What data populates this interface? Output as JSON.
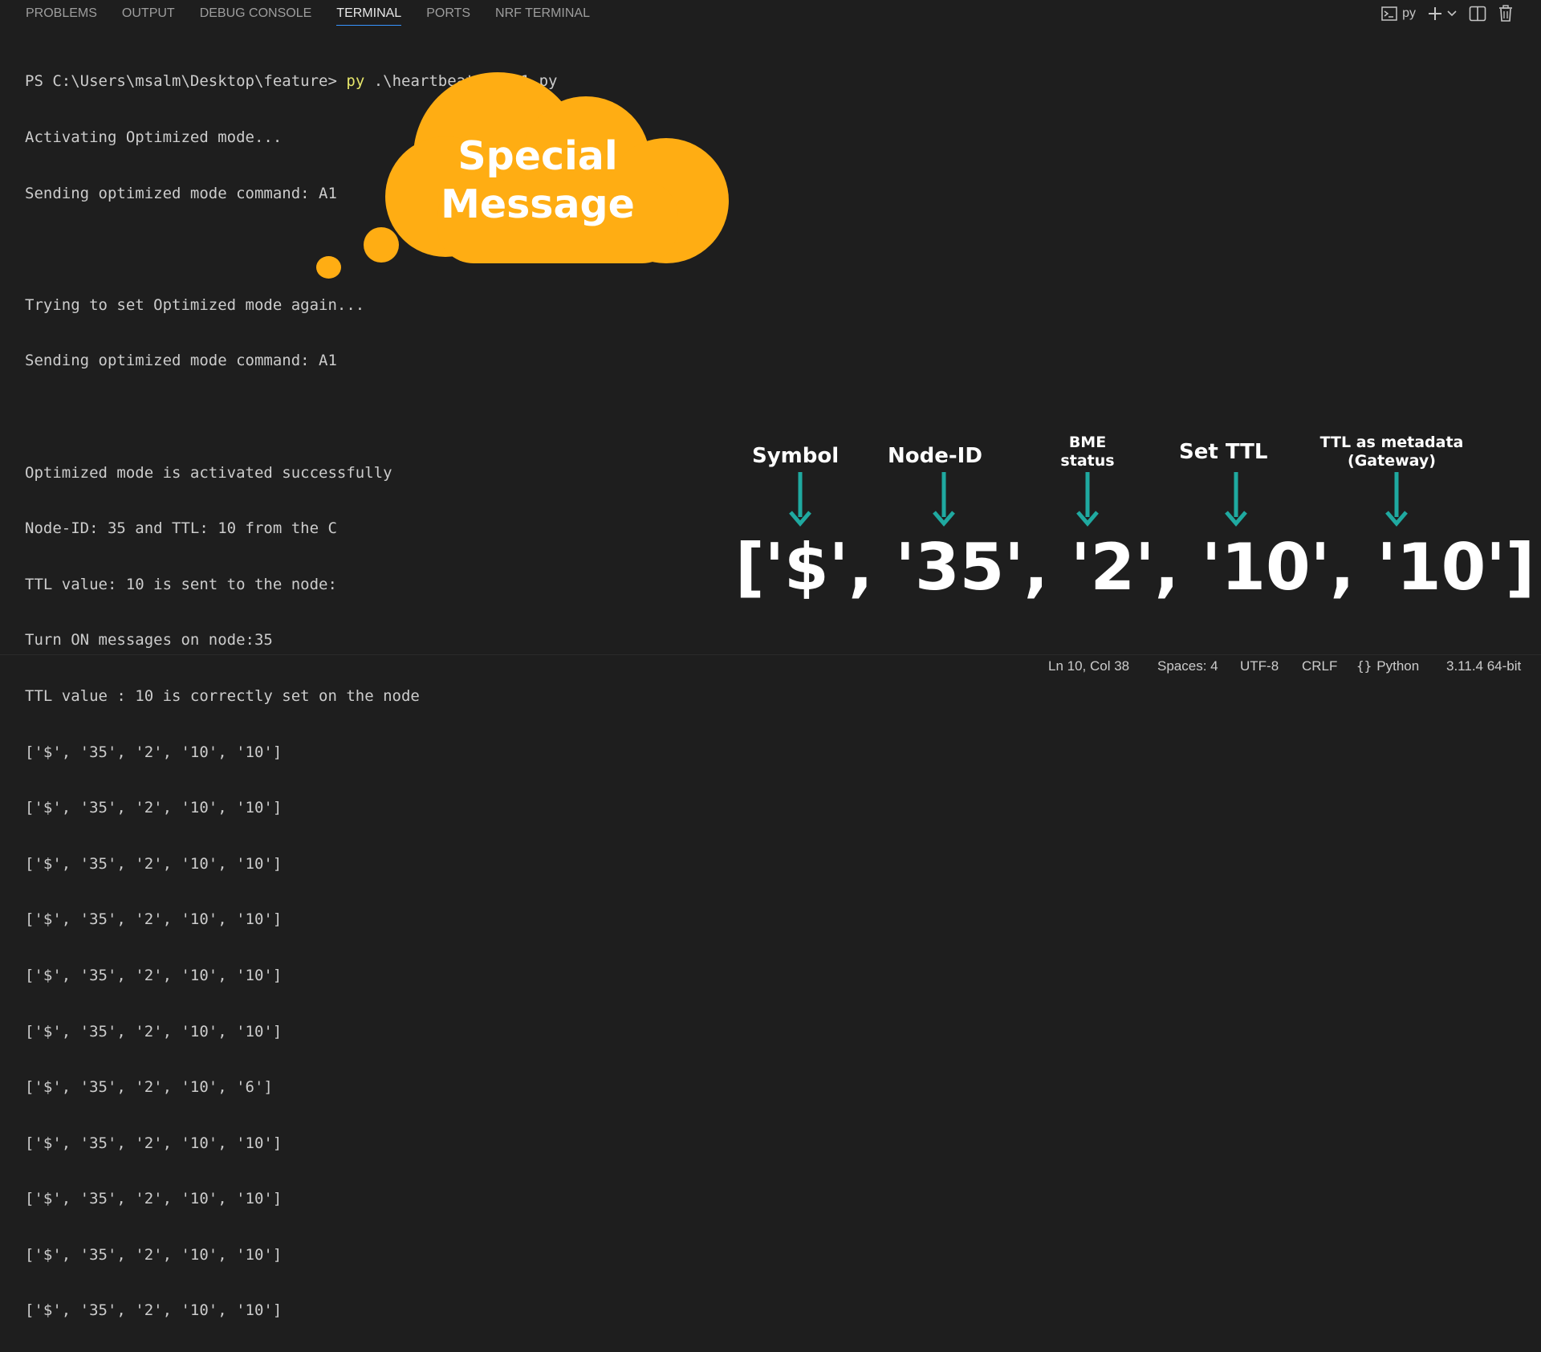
{
  "tabs": [
    {
      "label": "PROBLEMS"
    },
    {
      "label": "OUTPUT"
    },
    {
      "label": "DEBUG CONSOLE"
    },
    {
      "label": "TERMINAL",
      "active": true
    },
    {
      "label": "PORTS"
    },
    {
      "label": "NRF TERMINAL"
    }
  ],
  "terminal_actions": {
    "shell_label": "py"
  },
  "terminal": {
    "prompt": "PS C:\\Users\\msalm\\Desktop\\feature> ",
    "command": "py",
    "args": " .\\heartbeat_V1.01.py",
    "lines": [
      "Activating Optimized mode...",
      "Sending optimized mode command: A1",
      "",
      "Trying to set Optimized mode again...",
      "Sending optimized mode command: A1",
      "",
      "Optimized mode is activated successfully",
      "Node-ID: 35 and TTL: 10 from the C",
      "TTL value: 10 is sent to the node:",
      "Turn ON messages on node:35",
      "TTL value : 10 is correctly set on the node",
      "['$', '35', '2', '10', '10']",
      "['$', '35', '2', '10', '10']",
      "['$', '35', '2', '10', '10']",
      "['$', '35', '2', '10', '10']",
      "['$', '35', '2', '10', '10']",
      "['$', '35', '2', '10', '10']",
      "['$', '35', '2', '10', '6']",
      "['$', '35', '2', '10', '10']",
      "['$', '35', '2', '10', '10']",
      "['$', '35', '2', '10', '10']",
      "['$', '35', '2', '10', '10']"
    ]
  },
  "overlay": {
    "cloud_line1": "Special",
    "cloud_line2": "Message",
    "cloud_color": "#ffad13",
    "arrow_color": "#1fa9a0",
    "labels": {
      "symbol": "Symbol",
      "node_id": "Node-ID",
      "bme_line1": "BME",
      "bme_line2": "status",
      "set_ttl": "Set TTL",
      "ttl_meta_line1": "TTL  as metadata",
      "ttl_meta_line2": "(Gateway)"
    },
    "example_array": "['$', '35', '2', '10', '10']"
  },
  "statusbar": {
    "position": "Ln 10, Col 38",
    "spaces": "Spaces: 4",
    "encoding": "UTF-8",
    "eol": "CRLF",
    "language": "Python",
    "interpreter": "3.11.4 64-bit"
  }
}
